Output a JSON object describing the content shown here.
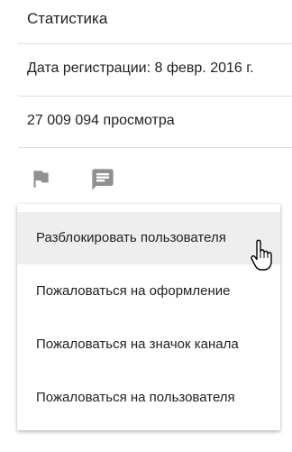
{
  "about": {
    "title": "Статистика",
    "registration": "Дата регистрации: 8 февр. 2016 г.",
    "views": "27 009 094 просмотра"
  },
  "actions": {
    "flag_icon": "flag-icon",
    "comment_icon": "comment-icon",
    "icon_color": "#909090"
  },
  "menu": {
    "items": [
      {
        "label": "Разблокировать пользователя",
        "highlighted": true
      },
      {
        "label": "Пожаловаться на оформление"
      },
      {
        "label": "Пожаловаться на значок канала"
      },
      {
        "label": "Пожаловаться на пользователя"
      }
    ]
  }
}
